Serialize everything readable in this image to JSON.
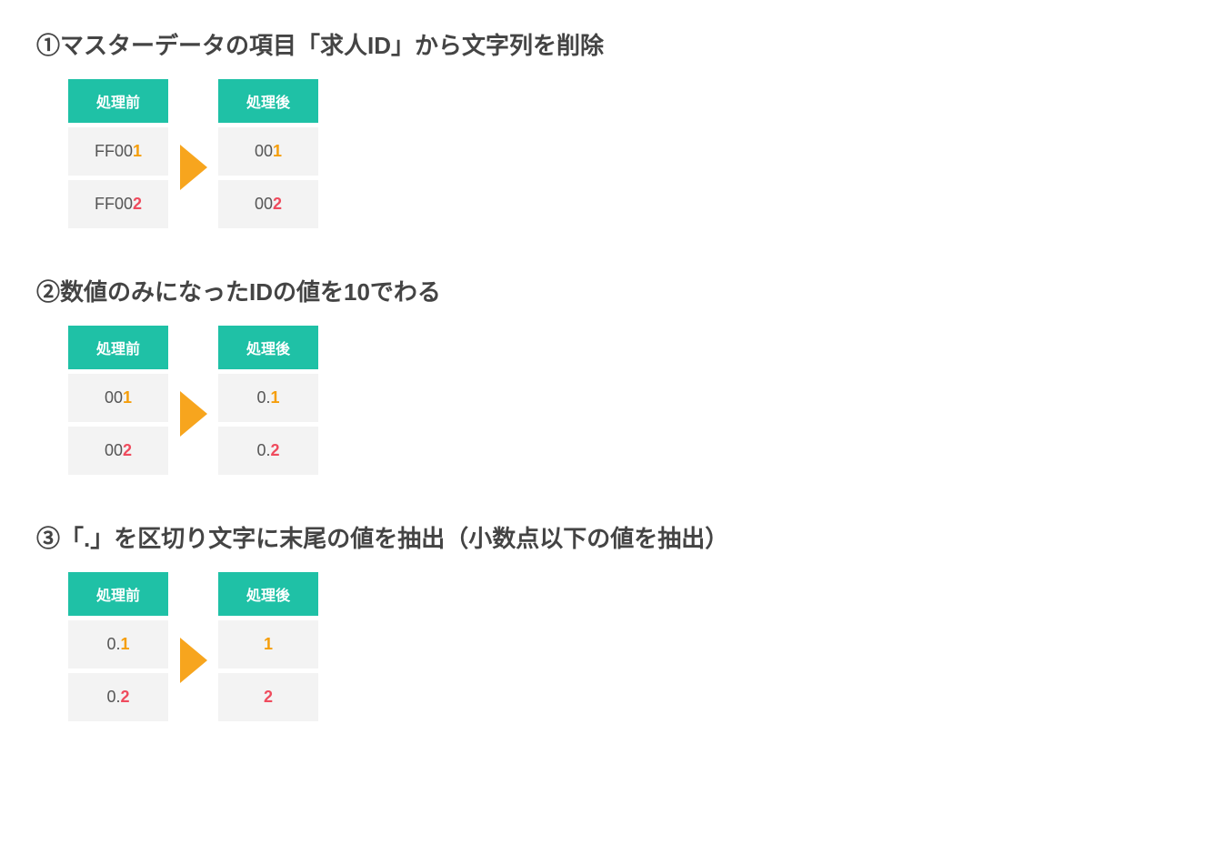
{
  "sections": [
    {
      "title": "①マスターデータの項目「求人ID」から文字列を削除",
      "before": {
        "header": "処理前",
        "row1_pre": "FF00",
        "row1_hl": "1",
        "row2_pre": "FF00",
        "row2_hl": "2"
      },
      "after": {
        "header": "処理後",
        "row1_pre": "00",
        "row1_hl": "1",
        "row2_pre": "00",
        "row2_hl": "2"
      },
      "hl1": "orange",
      "hl2": "red"
    },
    {
      "title": "②数値のみになったIDの値を10でわる",
      "before": {
        "header": "処理前",
        "row1_pre": "00",
        "row1_hl": "1",
        "row2_pre": "00",
        "row2_hl": "2"
      },
      "after": {
        "header": "処理後",
        "row1_pre": "0.",
        "row1_hl": "1",
        "row2_pre": "0.",
        "row2_hl": "2"
      },
      "hl1": "orange",
      "hl2": "red"
    },
    {
      "title": "③「.」を区切り文字に末尾の値を抽出（小数点以下の値を抽出）",
      "before": {
        "header": "処理前",
        "row1_pre": "0.",
        "row1_hl": "1",
        "row2_pre": "0.",
        "row2_hl": "2"
      },
      "after": {
        "header": "処理後",
        "row1_pre": "",
        "row1_hl": "1",
        "row2_pre": "",
        "row2_hl": "2"
      },
      "hl1": "orange",
      "hl2": "red"
    }
  ]
}
